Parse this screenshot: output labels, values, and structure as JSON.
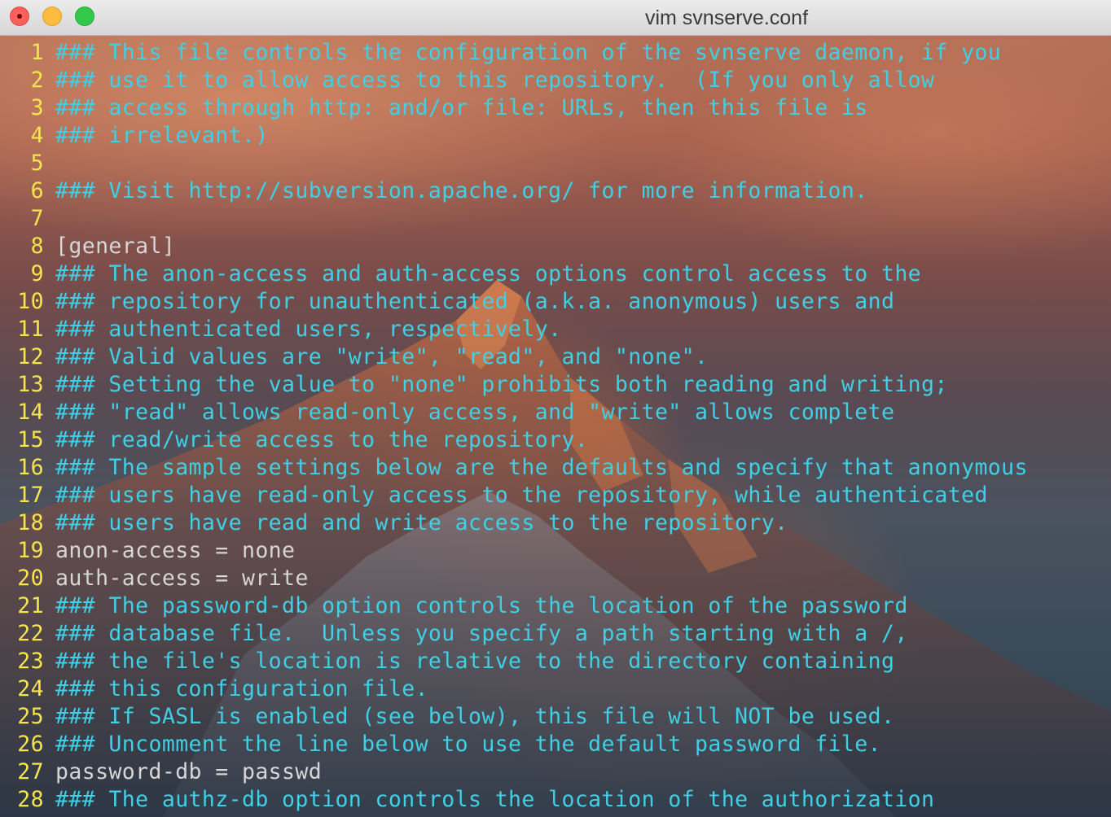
{
  "window": {
    "title": "vim svnserve.conf"
  },
  "editor": {
    "lines": [
      {
        "num": "1",
        "text": "### This file controls the configuration of the svnserve daemon, if you",
        "kind": "comment"
      },
      {
        "num": "2",
        "text": "### use it to allow access to this repository.  (If you only allow",
        "kind": "comment"
      },
      {
        "num": "3",
        "text": "### access through http: and/or file: URLs, then this file is",
        "kind": "comment"
      },
      {
        "num": "4",
        "text": "### irrelevant.)",
        "kind": "comment"
      },
      {
        "num": "5",
        "text": "",
        "kind": "plain"
      },
      {
        "num": "6",
        "text": "### Visit http://subversion.apache.org/ for more information.",
        "kind": "comment"
      },
      {
        "num": "7",
        "text": "",
        "kind": "plain"
      },
      {
        "num": "8",
        "text": "[general]",
        "kind": "plain"
      },
      {
        "num": "9",
        "text": "### The anon-access and auth-access options control access to the",
        "kind": "comment"
      },
      {
        "num": "10",
        "text": "### repository for unauthenticated (a.k.a. anonymous) users and",
        "kind": "comment"
      },
      {
        "num": "11",
        "text": "### authenticated users, respectively.",
        "kind": "comment"
      },
      {
        "num": "12",
        "text": "### Valid values are \"write\", \"read\", and \"none\".",
        "kind": "comment"
      },
      {
        "num": "13",
        "text": "### Setting the value to \"none\" prohibits both reading and writing;",
        "kind": "comment"
      },
      {
        "num": "14",
        "text": "### \"read\" allows read-only access, and \"write\" allows complete",
        "kind": "comment"
      },
      {
        "num": "15",
        "text": "### read/write access to the repository.",
        "kind": "comment"
      },
      {
        "num": "16",
        "text": "### The sample settings below are the defaults and specify that anonymous",
        "kind": "comment"
      },
      {
        "num": "17",
        "text": "### users have read-only access to the repository, while authenticated",
        "kind": "comment"
      },
      {
        "num": "18",
        "text": "### users have read and write access to the repository.",
        "kind": "comment"
      },
      {
        "num": "19",
        "text": "anon-access = none",
        "kind": "plain"
      },
      {
        "num": "20",
        "text": "auth-access = write",
        "kind": "plain"
      },
      {
        "num": "21",
        "text": "### The password-db option controls the location of the password",
        "kind": "comment"
      },
      {
        "num": "22",
        "text": "### database file.  Unless you specify a path starting with a /,",
        "kind": "comment"
      },
      {
        "num": "23",
        "text": "### the file's location is relative to the directory containing",
        "kind": "comment"
      },
      {
        "num": "24",
        "text": "### this configuration file.",
        "kind": "comment"
      },
      {
        "num": "25",
        "text": "### If SASL is enabled (see below), this file will NOT be used.",
        "kind": "comment"
      },
      {
        "num": "26",
        "text": "### Uncomment the line below to use the default password file.",
        "kind": "comment"
      },
      {
        "num": "27",
        "text": "password-db = passwd",
        "kind": "plain"
      },
      {
        "num": "28",
        "text": "### The authz-db option controls the location of the authorization",
        "kind": "comment"
      }
    ]
  },
  "colors": {
    "line_number": "#f4e54e",
    "comment": "#3fd0e6",
    "plain": "#d6d6d6"
  }
}
